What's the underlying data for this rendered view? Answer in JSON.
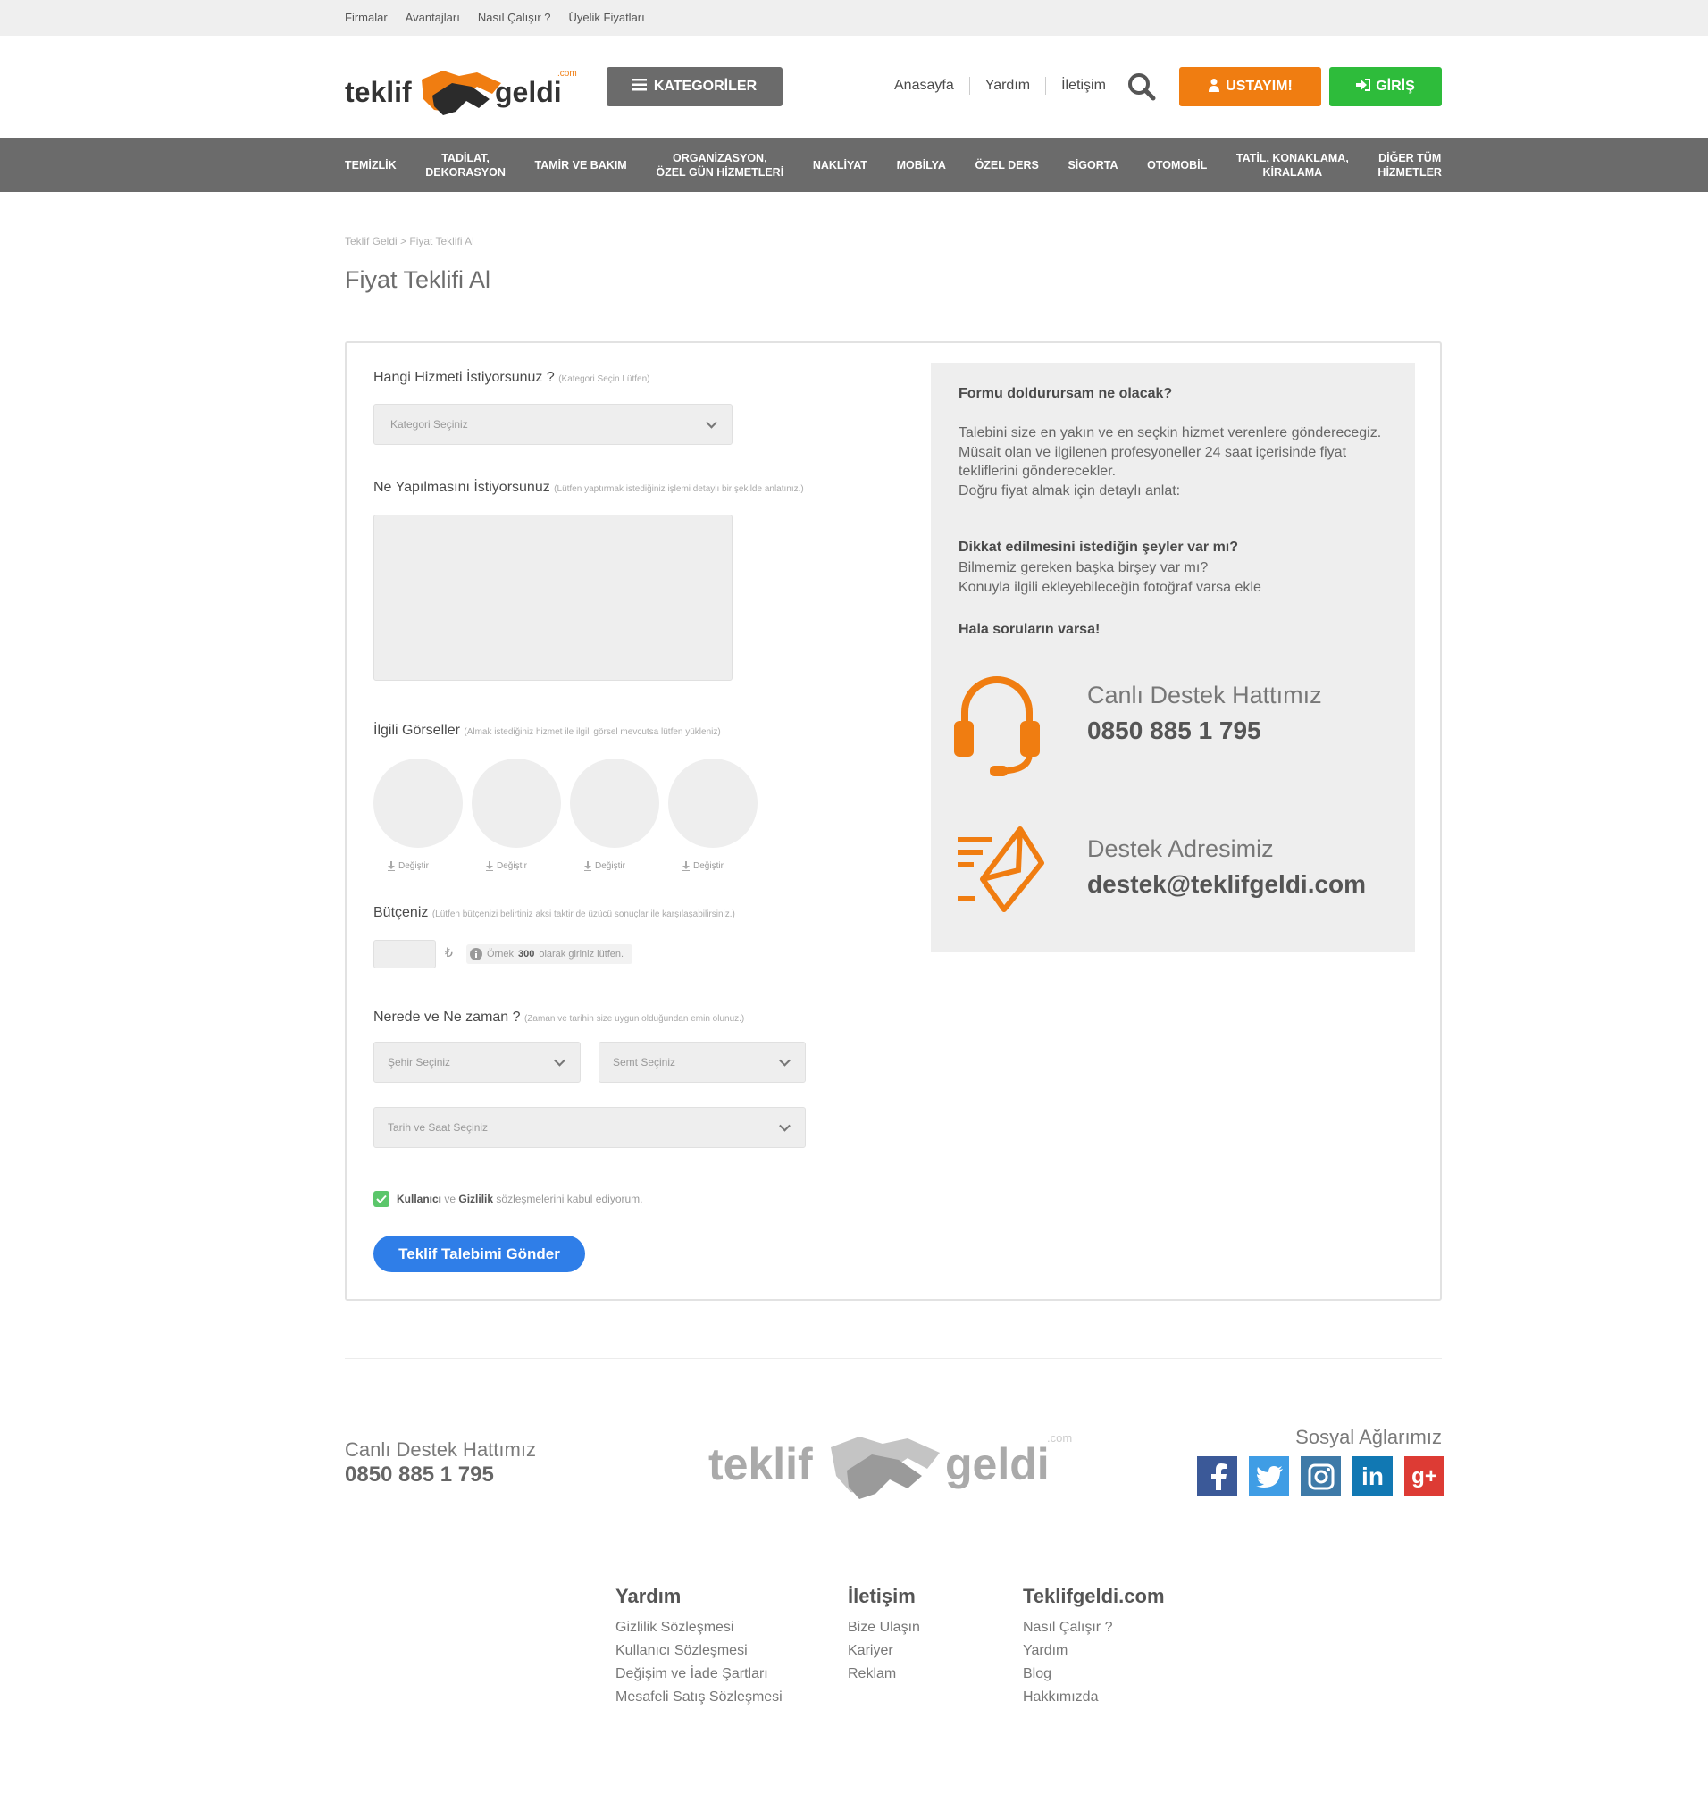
{
  "topbar": {
    "links": [
      "Firmalar",
      "Avantajları",
      "Nasıl Çalışır ?",
      "Üyelik Fiyatları"
    ]
  },
  "header": {
    "logo_text_left": "teklif",
    "logo_text_right": "geldi",
    "logo_com": ".com",
    "categories_button": "KATEGORİLER",
    "nav": [
      "Anasayfa",
      "Yardım",
      "İletişim"
    ],
    "usta_button": "USTAYIM!",
    "login_button": "GİRİŞ"
  },
  "catbar": [
    "TEMİZLİK",
    "TADİLAT,\nDEKORASYON",
    "TAMİR VE BAKIM",
    "ORGANİZASYON,\nÖZEL GÜN HİZMETLERİ",
    "NAKLİYAT",
    "MOBİLYA",
    "ÖZEL DERS",
    "SİGORTA",
    "OTOMOBİL",
    "TATİL, KONAKLAMA,\nKİRALAMA",
    "DİĞER TÜM\nHİZMETLER"
  ],
  "breadcrumb": "Teklif Geldi > Fiyat Teklifi Al",
  "page_title": "Fiyat Teklifi Al",
  "form": {
    "service_label": "Hangi Hizmeti İstiyorsunuz ?",
    "service_hint": "(Kategori Seçin Lütfen)",
    "service_placeholder": "Kategori Seçiniz",
    "desc_label": "Ne Yapılmasını İstiyorsunuz",
    "desc_hint": "(Lütfen yaptırmak istediğiniz işlemi detaylı bir şekilde anlatınız.)",
    "images_label": "İlgili Görseller",
    "images_hint": "(Almak istediğiniz hizmet ile ilgili görsel mevcutsa lütfen yükleniz)",
    "change_label": "Değiştir",
    "budget_label": "Bütçeniz",
    "budget_hint": "(Lütfen bütçenizi belirtiniz aksi taktir de üzücü sonuçlar ile karşılaşabilirsiniz.)",
    "currency": "₺",
    "budget_example_pre": "Örnek",
    "budget_example_num": "300",
    "budget_example_post": "olarak giriniz lütfen.",
    "where_label": "Nerede ve Ne zaman ?",
    "where_hint": "(Zaman ve tarihin size uygun olduğundan emin olunuz.)",
    "city_placeholder": "Şehir Seçiniz",
    "district_placeholder": "Semt Seçiniz",
    "date_placeholder": "Tarih ve Saat Seçiniz",
    "agree_user": "Kullanıcı",
    "agree_and": "ve",
    "agree_privacy": "Gizlilik",
    "agree_rest": "sözleşmelerini kabul ediyorum.",
    "submit": "Teklif Talebimi Gönder"
  },
  "info": {
    "q1": "Formu doldurursam ne olacak?",
    "p1": "Talebini size en yakın ve en seçkin hizmet verenlere gönderecegiz.\nMüsait olan ve ilgilenen profesyoneller 24 saat içerisinde fiyat tekliflerini gönderecekler.\nDoğru fiyat almak için detaylı anlat:",
    "q2": "Dikkat edilmesini istediğin şeyler var mı?",
    "p2": "Bilmemiz gereken başka birşey var mı?\nKonuyla ilgili ekleyebileceğin fotoğraf varsa ekle",
    "q3": "Hala soruların varsa!",
    "phone_title": "Canlı Destek Hattımız",
    "phone": "0850 885 1 795",
    "mail_title": "Destek Adresimiz",
    "mail": "destek@teklifgeldi.com"
  },
  "footer": {
    "phone_title": "Canlı Destek Hattımız",
    "phone": "0850 885 1 795",
    "social_title": "Sosyal Ağlarımız",
    "col1": {
      "title": "Yardım",
      "items": [
        "Gizlilik Sözleşmesi",
        "Kullanıcı Sözleşmesi",
        "Değişim ve İade Şartları",
        "Mesafeli Satış Sözleşmesi"
      ]
    },
    "col2": {
      "title": "İletişim",
      "items": [
        "Bize Ulaşın",
        "Kariyer",
        "Reklam"
      ]
    },
    "col3": {
      "title": "Teklifgeldi.com",
      "items": [
        "Nasıl Çalışır ?",
        "Yardım",
        "Blog",
        "Hakkımızda"
      ]
    }
  },
  "colors": {
    "orange": "#f07d11",
    "green": "#2ebc3b",
    "blue": "#2f7ee8",
    "gray_bar": "#6b6b6b"
  }
}
